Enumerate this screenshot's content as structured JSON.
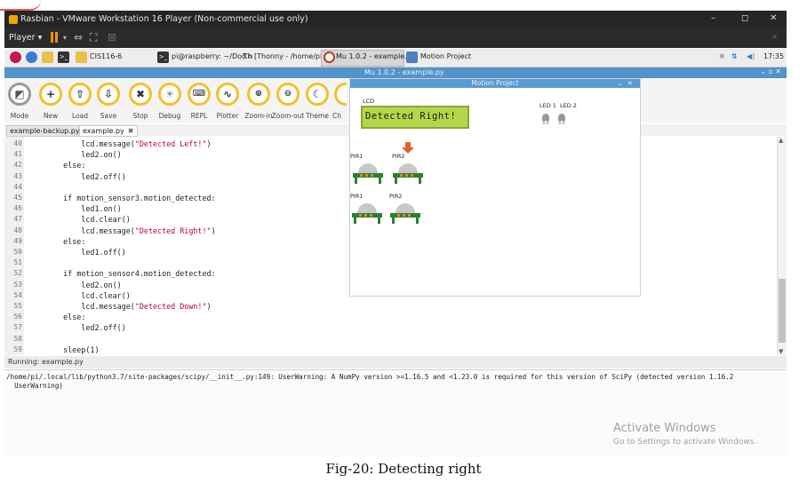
{
  "vm": {
    "title": "Rasbian - VMware Workstation 16 Player (Non-commercial use only)",
    "player_label": "Player",
    "controls": {
      "minimize": "–",
      "maximize": "◻",
      "close": "✕"
    }
  },
  "taskbar": {
    "folder_label": "CIS116-6",
    "items": [
      "pi@raspberry: ~/Doc...",
      "[Thonny - /home/pi/...",
      "Mu 1.0.2 - example.py",
      "Motion Project"
    ],
    "clock": "17:35"
  },
  "mu": {
    "title": "Mu 1.0.2 - example.py",
    "toolbar": [
      {
        "label": "Mode",
        "icon": "mode-icon"
      },
      {
        "label": "New",
        "icon": "plus-icon"
      },
      {
        "label": "Load",
        "icon": "upload-icon"
      },
      {
        "label": "Save",
        "icon": "download-icon"
      },
      {
        "label": "Stop",
        "icon": "close-icon"
      },
      {
        "label": "Debug",
        "icon": "bug-icon"
      },
      {
        "label": "REPL",
        "icon": "keyboard-icon"
      },
      {
        "label": "Plotter",
        "icon": "pulse-icon"
      },
      {
        "label": "Zoom-in",
        "icon": "zoom-in-icon"
      },
      {
        "label": "Zoom-out",
        "icon": "zoom-out-icon"
      },
      {
        "label": "Theme",
        "icon": "moon-icon"
      },
      {
        "label": "Ch",
        "icon": "check-icon"
      }
    ],
    "tabs": [
      {
        "label": "example-backup.py"
      },
      {
        "label": "example.py"
      }
    ],
    "code": [
      {
        "n": "40",
        "text": "        lcd.message(",
        "str": "\"Detected Left!\"",
        "tail": ")"
      },
      {
        "n": "41",
        "text": "        led2.on()"
      },
      {
        "n": "42",
        "text": "    else:"
      },
      {
        "n": "43",
        "text": "        led2.off()"
      },
      {
        "n": "44",
        "text": ""
      },
      {
        "n": "45",
        "text": "    if motion_sensor3.motion_detected:"
      },
      {
        "n": "46",
        "text": "        led1.on()"
      },
      {
        "n": "47",
        "text": "        lcd.clear()"
      },
      {
        "n": "48",
        "text": "        lcd.message(",
        "str": "\"Detected Right!\"",
        "tail": ")"
      },
      {
        "n": "49",
        "text": "    else:"
      },
      {
        "n": "50",
        "text": "        led1.off()"
      },
      {
        "n": "51",
        "text": ""
      },
      {
        "n": "52",
        "text": "    if motion_sensor4.motion_detected:"
      },
      {
        "n": "53",
        "text": "        led2.on()"
      },
      {
        "n": "54",
        "text": "        lcd.clear()"
      },
      {
        "n": "55",
        "text": "        lcd.message(",
        "str": "\"Detected Down!\"",
        "tail": ")"
      },
      {
        "n": "56",
        "text": "    else:"
      },
      {
        "n": "57",
        "text": "        led2.off()"
      },
      {
        "n": "58",
        "text": ""
      },
      {
        "n": "59",
        "text": "    sleep(1)"
      }
    ],
    "status": "Running: example.py",
    "repl_output": "/home/pi/.local/lib/python3.7/site-packages/scipy/__init__.py:149: UserWarning: A NumPy version >=1.16.5 and <1.23.0 is required for this version of SciPy (detected version 1.16.2\n  UserWarning)"
  },
  "motion_project": {
    "title": "Motion Project",
    "lcd_label": "LCD",
    "lcd_text": "Detected Right!",
    "led1_label": "LED 1",
    "led2_label": "LED 2",
    "pir_labels": [
      "PIR1",
      "PIR2",
      "PIR1",
      "PIR2"
    ]
  },
  "activate": {
    "line1": "Activate Windows",
    "line2": "Go to Settings to activate Windows."
  },
  "caption": "Fig-20: Detecting right",
  "colors": {
    "accent_yellow": "#f3c12d",
    "mu_title_blue": "#5294c9",
    "lcd_green": "#b6d64a",
    "string_color": "#b4004e",
    "pir_board_green": "#2e7d32"
  }
}
